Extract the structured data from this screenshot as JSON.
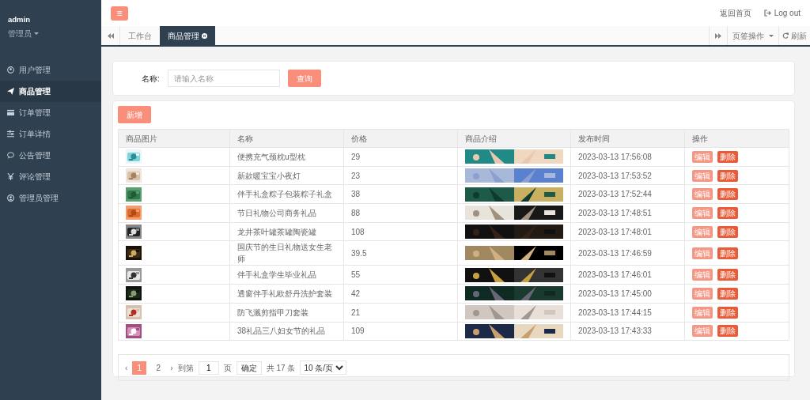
{
  "user": {
    "name": "admin",
    "role": "管理员"
  },
  "sidebar": {
    "items": [
      {
        "label": "用户管理",
        "selected": false
      },
      {
        "label": "商品管理",
        "selected": true
      },
      {
        "label": "订单管理",
        "selected": false
      },
      {
        "label": "订单详情",
        "selected": false
      },
      {
        "label": "公告管理",
        "selected": false
      },
      {
        "label": "评论管理",
        "selected": false
      },
      {
        "label": "管理员管理",
        "selected": false
      }
    ]
  },
  "header": {
    "menu_button": "≡",
    "links": [
      "返回首页",
      "Log out"
    ]
  },
  "tabs": [
    {
      "label": "工作台",
      "selected": false,
      "closable": false
    },
    {
      "label": "商品管理",
      "selected": true,
      "closable": true
    }
  ],
  "tab_tools": {
    "page_ops": "页签操作",
    "refresh": "刷新"
  },
  "search": {
    "label": "名称:",
    "placeholder": "请输入名称",
    "button": "查询"
  },
  "toolbar": {
    "add_button": "新增"
  },
  "table": {
    "columns": [
      "商品图片",
      "名称",
      "价格",
      "商品介绍",
      "发布时间",
      "操作"
    ],
    "rows": [
      {
        "name": "便携充气颈枕u型枕",
        "price": "29",
        "time": "2023-03-13 17:56:08",
        "actions": [
          "编辑",
          "删除"
        ]
      },
      {
        "name": "新款暖宝宝小夜灯",
        "price": "23",
        "time": "2023-03-13 17:53:52",
        "actions": [
          "编辑",
          "删除"
        ]
      },
      {
        "name": "伴手礼盒粽子包装粽子礼盒",
        "price": "38",
        "time": "2023-03-13 17:52:44",
        "actions": [
          "编辑",
          "删除"
        ]
      },
      {
        "name": "节日礼物公司商务礼品",
        "price": "88",
        "time": "2023-03-13 17:48:51",
        "actions": [
          "编辑",
          "删除"
        ]
      },
      {
        "name": "龙井茶叶罐茶罐陶瓷罐",
        "price": "108",
        "time": "2023-03-13 17:48:01",
        "actions": [
          "编辑",
          "删除"
        ]
      },
      {
        "name": "国庆节的生日礼物送女生老师",
        "price": "39.5",
        "time": "2023-03-13 17:46:59",
        "actions": [
          "编辑",
          "删除"
        ]
      },
      {
        "name": "伴手礼盒学生毕业礼品",
        "price": "55",
        "time": "2023-03-13 17:46:01",
        "actions": [
          "编辑",
          "删除"
        ]
      },
      {
        "name": "透窗伴手礼欧舒丹洗护套装",
        "price": "42",
        "time": "2023-03-13 17:45:00",
        "actions": [
          "编辑",
          "删除"
        ]
      },
      {
        "name": "防飞溅剪指甲刀套装",
        "price": "21",
        "time": "2023-03-13 17:44:15",
        "actions": [
          "编辑",
          "删除"
        ]
      },
      {
        "name": "38礼品三八妇女节的礼品",
        "price": "109",
        "time": "2023-03-13 17:43:33",
        "actions": [
          "编辑",
          "删除"
        ]
      }
    ]
  },
  "pagination": {
    "prev": "‹",
    "pages": [
      {
        "label": "1",
        "selected": true
      },
      {
        "label": "2",
        "selected": false
      }
    ],
    "next": "›",
    "goto_label": "到第",
    "goto_value": "1",
    "page_unit": "页",
    "confirm": "确定",
    "total": "共 17 条",
    "page_size": "10 条/页"
  }
}
